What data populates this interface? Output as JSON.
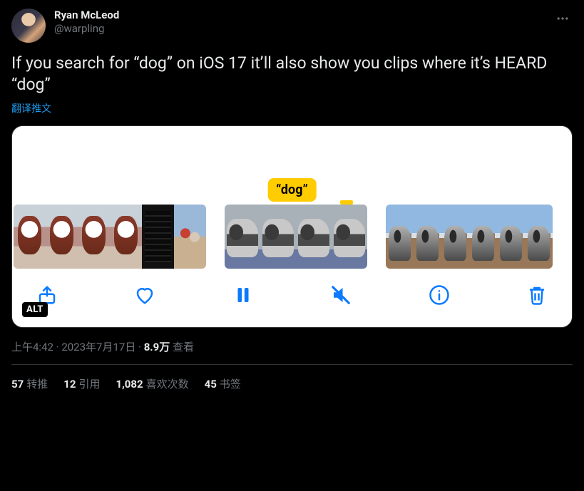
{
  "author": {
    "display_name": "Ryan McLeod",
    "handle": "@warpling"
  },
  "body": "If you search for “dog” on iOS 17 it’ll also show you clips where it’s HEARD “dog”",
  "translate_label": "翻译推文",
  "media": {
    "caption_badge": "“dog”",
    "alt_badge": "ALT"
  },
  "meta": {
    "time": "上午4:42",
    "sep1": " · ",
    "date": "2023年7月17日",
    "sep2": " · ",
    "views_num": "8.9万",
    "views_label": " 查看"
  },
  "stats": {
    "retweets_num": "57",
    "retweets_label": "转推",
    "quotes_num": "12",
    "quotes_label": "引用",
    "likes_num": "1,082",
    "likes_label": "喜欢次数",
    "bookmarks_num": "45",
    "bookmarks_label": "书签"
  }
}
